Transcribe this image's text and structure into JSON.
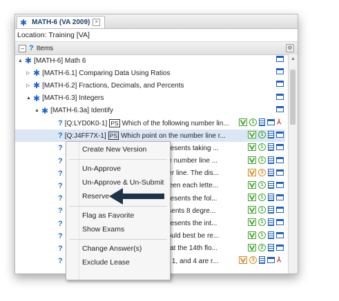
{
  "tab": {
    "title": "MATH-6 (VA 2009)"
  },
  "location": "Location: Training [VA]",
  "items_header": {
    "label": "Items"
  },
  "tree": [
    {
      "indent": 0,
      "expander": "▲",
      "star": true,
      "label": "[MATH-6] Math 6"
    },
    {
      "indent": 1,
      "expander": "▷",
      "star": true,
      "label": "[MATH-6.1] Comparing Data Using Ratios"
    },
    {
      "indent": 1,
      "expander": "▷",
      "star": true,
      "label": "[MATH-6.2] Fractions, Decimals, and Percents"
    },
    {
      "indent": 1,
      "expander": "▲",
      "star": true,
      "label": "[MATH-6.3] Integers"
    },
    {
      "indent": 2,
      "expander": "▲",
      "star": true,
      "label": "[MATH-6.3a] Identify"
    }
  ],
  "questions": [
    {
      "id": "[Q:LYD0K0-1]",
      "ps": "PS",
      "text": "Which of the following number lin...",
      "v": "green",
      "num": "1",
      "pdf": true
    },
    {
      "id": "[Q:J4FF7X-1]",
      "ps": "PS",
      "text": "Which point on the number line r...",
      "v": "green",
      "num": "1",
      "pdf": false,
      "selected": true
    },
    {
      "text": "presents taking ...",
      "v": "green",
      "num": "1"
    },
    {
      "text": "he number line ...",
      "v": "green",
      "num": "1"
    },
    {
      "text": "ber line. The dis...",
      "v": "orange",
      "num": "3"
    },
    {
      "text": "ween each lette...",
      "v": "green",
      "num": "1"
    },
    {
      "text": "presents the fol...",
      "v": "green",
      "num": "1"
    },
    {
      "text": "esents 8 degre...",
      "v": "green",
      "num": "1"
    },
    {
      "text": "presents the int...",
      "v": "green",
      "num": "1"
    },
    {
      "text": "could best be re...",
      "v": "green",
      "num": "1"
    },
    {
      "text": "n at the 14th flo...",
      "v": "green",
      "num": "2"
    },
    {
      "text": "0, 1, and 4 are r...",
      "v": "orange",
      "num": "3",
      "pdf": true
    }
  ],
  "context_menu": {
    "items": [
      "Create New Version",
      "Un-Approve",
      "Un-Approve & Un-Submit",
      "Reserve",
      "Flag as Favorite",
      "Show Exams",
      "Change Answer(s)",
      "Exclude Lease"
    ]
  },
  "colors": {
    "accent": "#1b63c7",
    "arrow": "#1f3448",
    "green": "#3ea32a",
    "orange": "#d4891c"
  }
}
